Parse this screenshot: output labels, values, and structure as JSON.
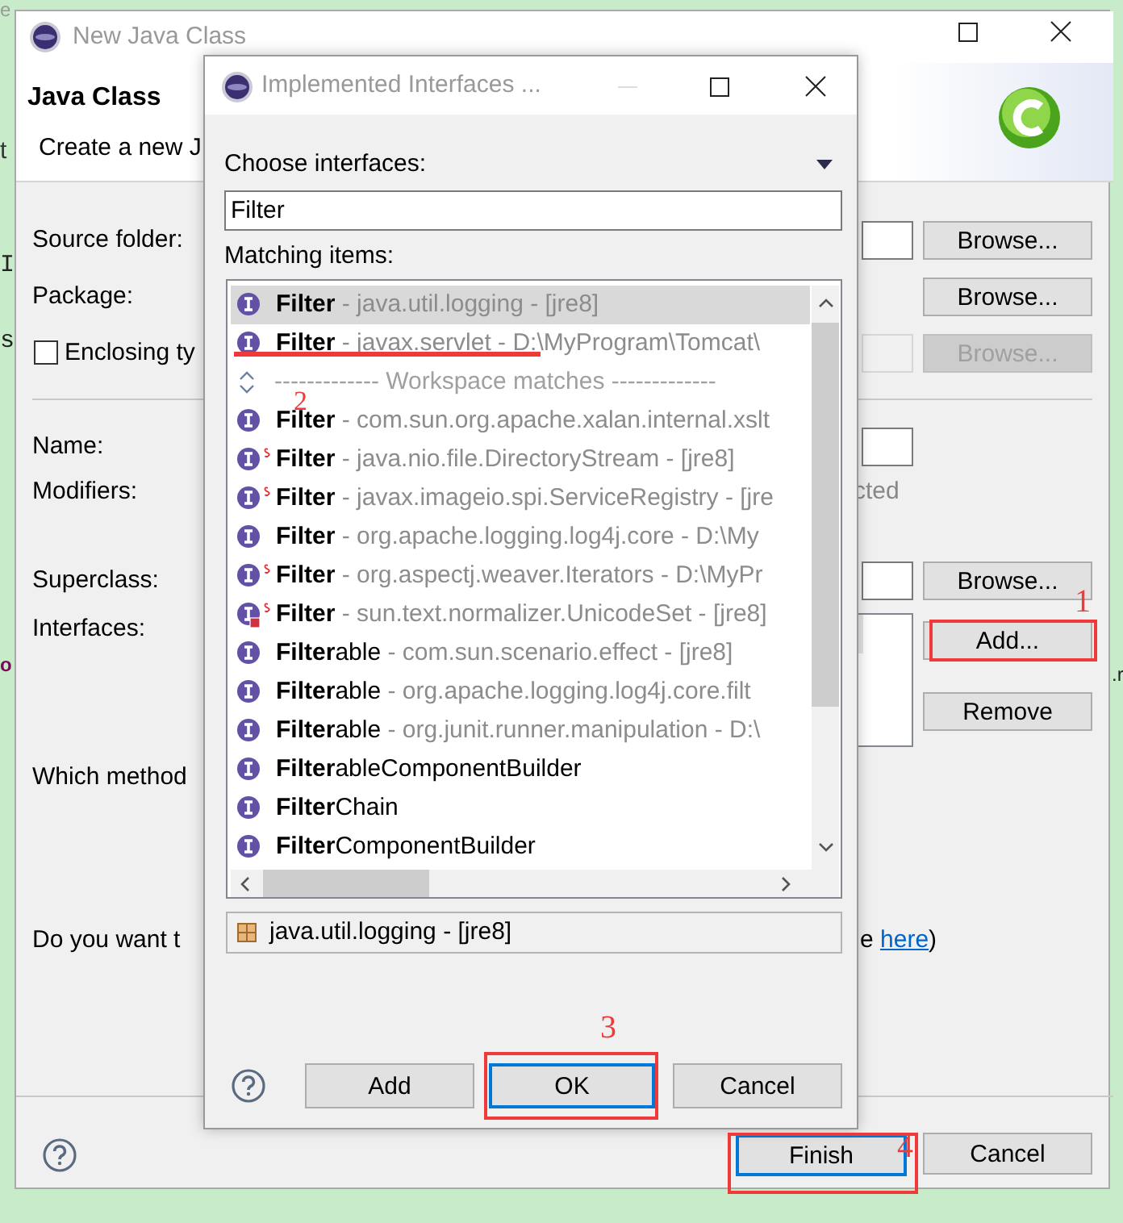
{
  "background_fragments": [
    "e",
    "t",
    "I",
    "s",
    "o",
    ".r"
  ],
  "main_window": {
    "title": "New Java Class",
    "heading": "Java Class",
    "description": "Create a new J",
    "source_folder": {
      "label": "Source folder:",
      "button": "Browse..."
    },
    "package": {
      "label": "Package:",
      "button": "Browse..."
    },
    "enclosing_type": {
      "label": "Enclosing ty",
      "checked": false,
      "button": "Browse...",
      "disabled": true
    },
    "name": {
      "label": "Name:"
    },
    "modifiers": {
      "label": "Modifiers:",
      "option_fragment": "cted"
    },
    "superclass": {
      "label": "Superclass:",
      "button": "Browse..."
    },
    "interfaces": {
      "label": "Interfaces:",
      "buttons": [
        "Add...",
        "Remove"
      ]
    },
    "methods_prompt": "Which method",
    "comments_prompt": {
      "text": "Do you want t",
      "tail": "e ",
      "link": "here",
      "end": ")"
    },
    "buttons": [
      {
        "label": "Finish",
        "default": true
      },
      {
        "label": "Cancel",
        "default": false
      }
    ]
  },
  "interfaces_dialog": {
    "title": "Implemented Interfaces ...",
    "filter_label": "Choose interfaces:",
    "filter_value": "Filter",
    "matching_label": "Matching items:",
    "items": [
      {
        "kind": "interface",
        "name": "**Filter**",
        "detail": "- java.util.logging - [jre8]",
        "selected": true
      },
      {
        "kind": "interface",
        "name": "**Filter**",
        "detail": "- javax.servlet - D:\\MyProgram\\Tomcat\\",
        "selected": false
      },
      {
        "kind": "separator",
        "detail": "------------- Workspace matches -------------",
        "selected": false
      },
      {
        "kind": "interface",
        "name": "**Filter**",
        "detail": "- com.sun.org.apache.xalan.internal.xslt",
        "selected": false
      },
      {
        "kind": "interface_static",
        "name": "**Filter**",
        "detail": "- java.nio.file.DirectoryStream - [jre8]",
        "selected": false
      },
      {
        "kind": "interface_static",
        "name": "**Filter**",
        "detail": "- javax.imageio.spi.ServiceRegistry - [jre",
        "selected": false
      },
      {
        "kind": "interface",
        "name": "**Filter**",
        "detail": "- org.apache.logging.log4j.core - D:\\My",
        "selected": false
      },
      {
        "kind": "interface_static",
        "name": "**Filter**",
        "detail": "- org.aspectj.weaver.Iterators - D:\\MyPr",
        "selected": false
      },
      {
        "kind": "interface_private_static",
        "name": "**Filter**",
        "detail": "- sun.text.normalizer.UnicodeSet - [jre8]",
        "selected": false
      },
      {
        "kind": "interface",
        "name": "**Filter**able",
        "detail": "- com.sun.scenario.effect - [jre8]",
        "selected": false
      },
      {
        "kind": "interface",
        "name": "**Filter**able",
        "detail": "- org.apache.logging.log4j.core.filt",
        "selected": false
      },
      {
        "kind": "interface",
        "name": "**Filter**able",
        "detail": "- org.junit.runner.manipulation - D:\\",
        "selected": false
      },
      {
        "kind": "interface",
        "name": "**Filter**ableComponentBuilder",
        "selected": false
      },
      {
        "kind": "interface",
        "name": "**Filter**Chain",
        "selected": false
      },
      {
        "kind": "interface",
        "name": "**Filter**ComponentBuilder",
        "selected": false
      }
    ],
    "status": "java.util.logging - [jre8]",
    "buttons": [
      {
        "label": "Add",
        "default": false
      },
      {
        "label": "OK",
        "default": true
      },
      {
        "label": "Cancel",
        "default": false
      }
    ]
  },
  "annotations": [
    {
      "label": "1",
      "kind": "box"
    },
    {
      "label": "2",
      "kind": "underline"
    },
    {
      "label": "3",
      "kind": "box"
    },
    {
      "label": "4",
      "kind": "box"
    }
  ]
}
